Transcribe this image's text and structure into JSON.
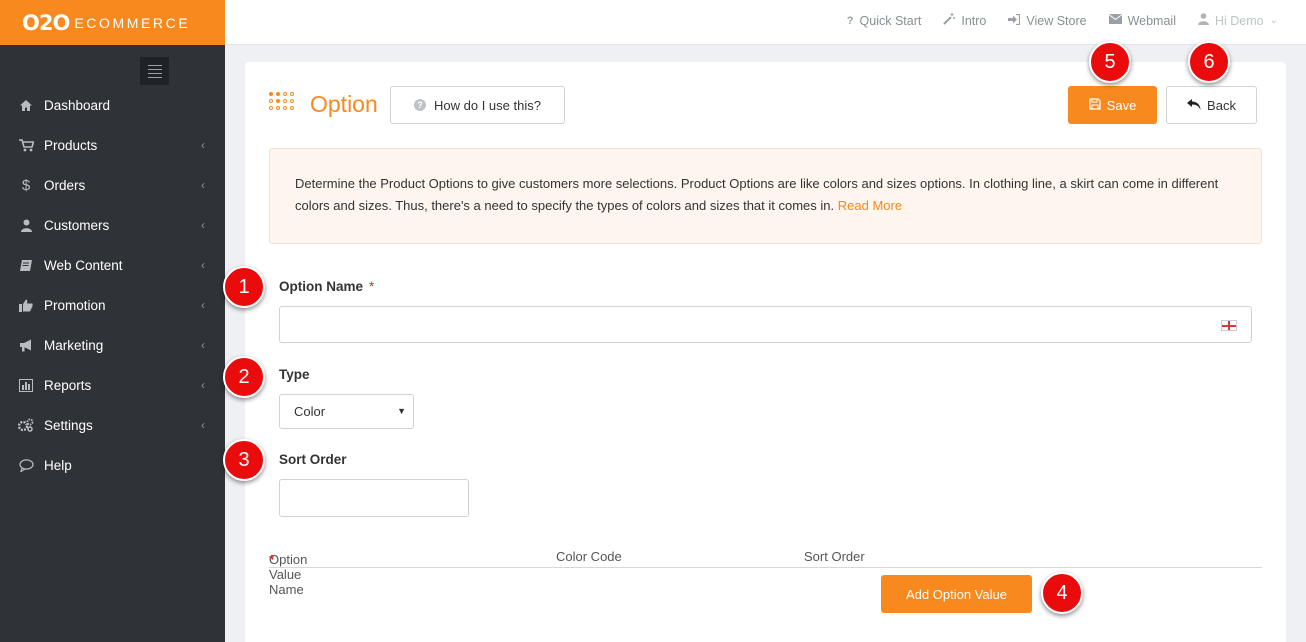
{
  "brand": {
    "logo_main": "O2O",
    "logo_sub": "ECOMMERCE"
  },
  "sidebar": {
    "items": [
      {
        "label": "Dashboard",
        "icon": "home-icon",
        "has_arrow": false
      },
      {
        "label": "Products",
        "icon": "cart-icon",
        "has_arrow": true
      },
      {
        "label": "Orders",
        "icon": "dollar-icon",
        "has_arrow": true
      },
      {
        "label": "Customers",
        "icon": "user-icon",
        "has_arrow": true
      },
      {
        "label": "Web Content",
        "icon": "book-icon",
        "has_arrow": true
      },
      {
        "label": "Promotion",
        "icon": "thumbs-up-icon",
        "has_arrow": true
      },
      {
        "label": "Marketing",
        "icon": "bullhorn-icon",
        "has_arrow": true
      },
      {
        "label": "Reports",
        "icon": "bar-chart-icon",
        "has_arrow": true
      },
      {
        "label": "Settings",
        "icon": "gears-icon",
        "has_arrow": true
      },
      {
        "label": "Help",
        "icon": "speech-bubble-icon",
        "has_arrow": false
      }
    ]
  },
  "topbar": {
    "quick_start": "Quick Start",
    "intro": "Intro",
    "view_store": "View Store",
    "webmail": "Webmail",
    "user": "Hi Demo"
  },
  "page": {
    "title": "Option",
    "help_button": "How do I use this?",
    "save_button": "Save",
    "back_button": "Back",
    "info_text": "Determine the Product Options to give customers more selections. Product Options are like colors and sizes options. In clothing line, a skirt can come in different colors and sizes. Thus, there's a need to specify the types of colors and sizes that it comes in.",
    "read_more": "Read More"
  },
  "form": {
    "option_name_label": "Option Name",
    "option_name_required": "*",
    "option_name_value": "",
    "type_label": "Type",
    "type_value": "Color",
    "sort_order_label": "Sort Order",
    "sort_order_value": ""
  },
  "option_values_table": {
    "columns": [
      "Option Value Name",
      "Color Code",
      "Sort Order"
    ],
    "required_marker": "*",
    "add_button": "Add Option Value"
  },
  "callouts": [
    "1",
    "2",
    "3",
    "4",
    "5",
    "6"
  ],
  "colors": {
    "accent": "#f7891f",
    "sidebar_bg": "#2f3338",
    "callout": "#ea0c0c"
  }
}
